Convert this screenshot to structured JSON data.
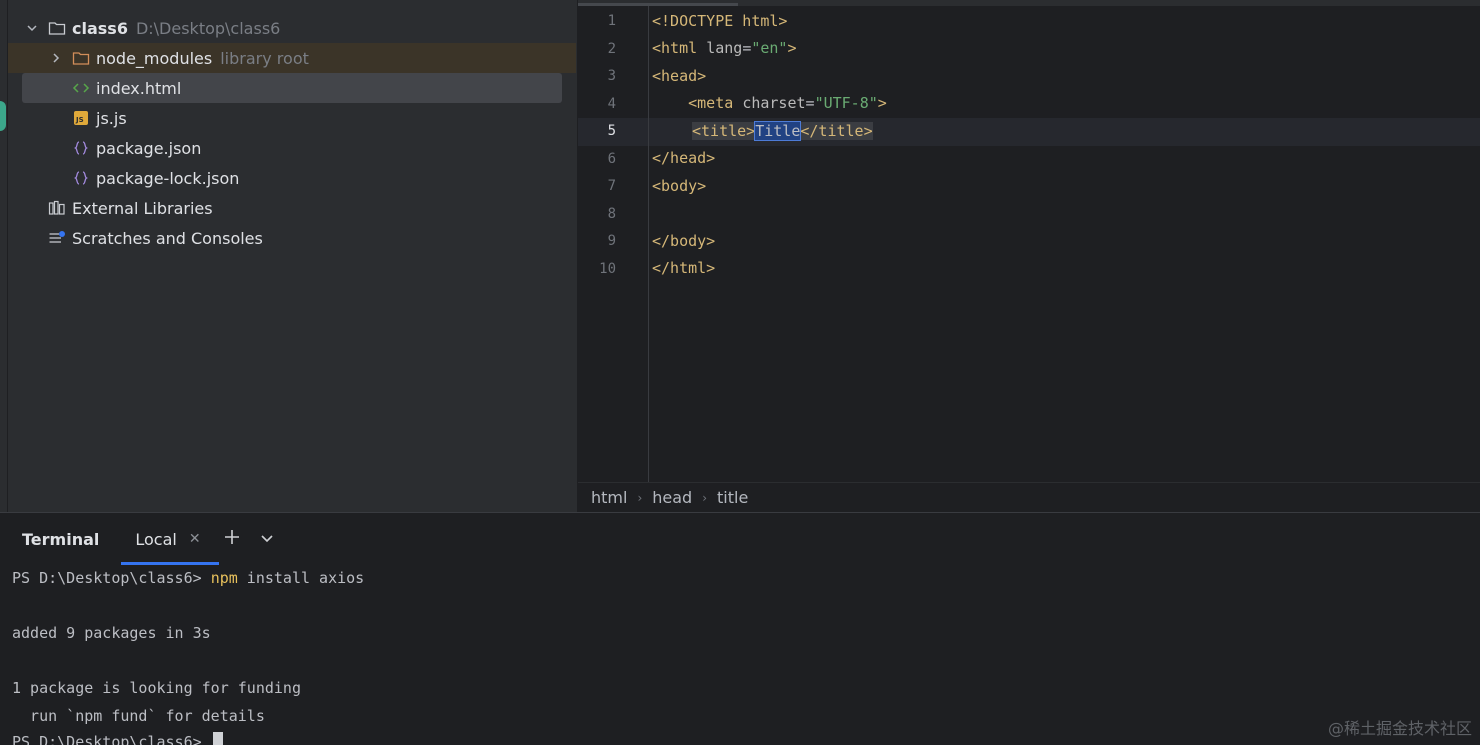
{
  "project_tree": {
    "root": {
      "name": "class6",
      "path": "D:\\Desktop\\class6"
    },
    "items": [
      {
        "name": "node_modules",
        "note": "library root"
      },
      {
        "name": "index.html"
      },
      {
        "name": "js.js"
      },
      {
        "name": "package.json"
      },
      {
        "name": "package-lock.json"
      }
    ],
    "external_libraries": "External Libraries",
    "scratches": "Scratches and Consoles"
  },
  "editor": {
    "line_numbers": [
      "1",
      "2",
      "3",
      "4",
      "5",
      "6",
      "7",
      "8",
      "9",
      "10"
    ],
    "current_line": "5",
    "lines": {
      "l1": "<!DOCTYPE html>",
      "l2a": "<html ",
      "l2b": "lang",
      "l2c": "=",
      "l2d": "\"en\"",
      "l2e": ">",
      "l3": "<head>",
      "l4a": "    <meta ",
      "l4b": "charset",
      "l4c": "=",
      "l4d": "\"UTF-8\"",
      "l4e": ">",
      "l5a": "<title>",
      "l5b": "Title",
      "l5c": "</title>",
      "l6": "</head>",
      "l7": "<body>",
      "l9": "</body>",
      "l10": "</html>"
    }
  },
  "breadcrumb": [
    "html",
    "head",
    "title"
  ],
  "terminal": {
    "title": "Terminal",
    "tab": "Local",
    "lines": {
      "prompt1": "PS D:\\Desktop\\class6> ",
      "cmd": "npm",
      "args": " install axios",
      "added": "added 9 packages in 3s",
      "funding1": "1 package is looking for funding",
      "funding2": "  run `npm fund` for details",
      "prompt2": "PS D:\\Desktop\\class6> "
    }
  },
  "watermark": "@稀土掘金技术社区"
}
